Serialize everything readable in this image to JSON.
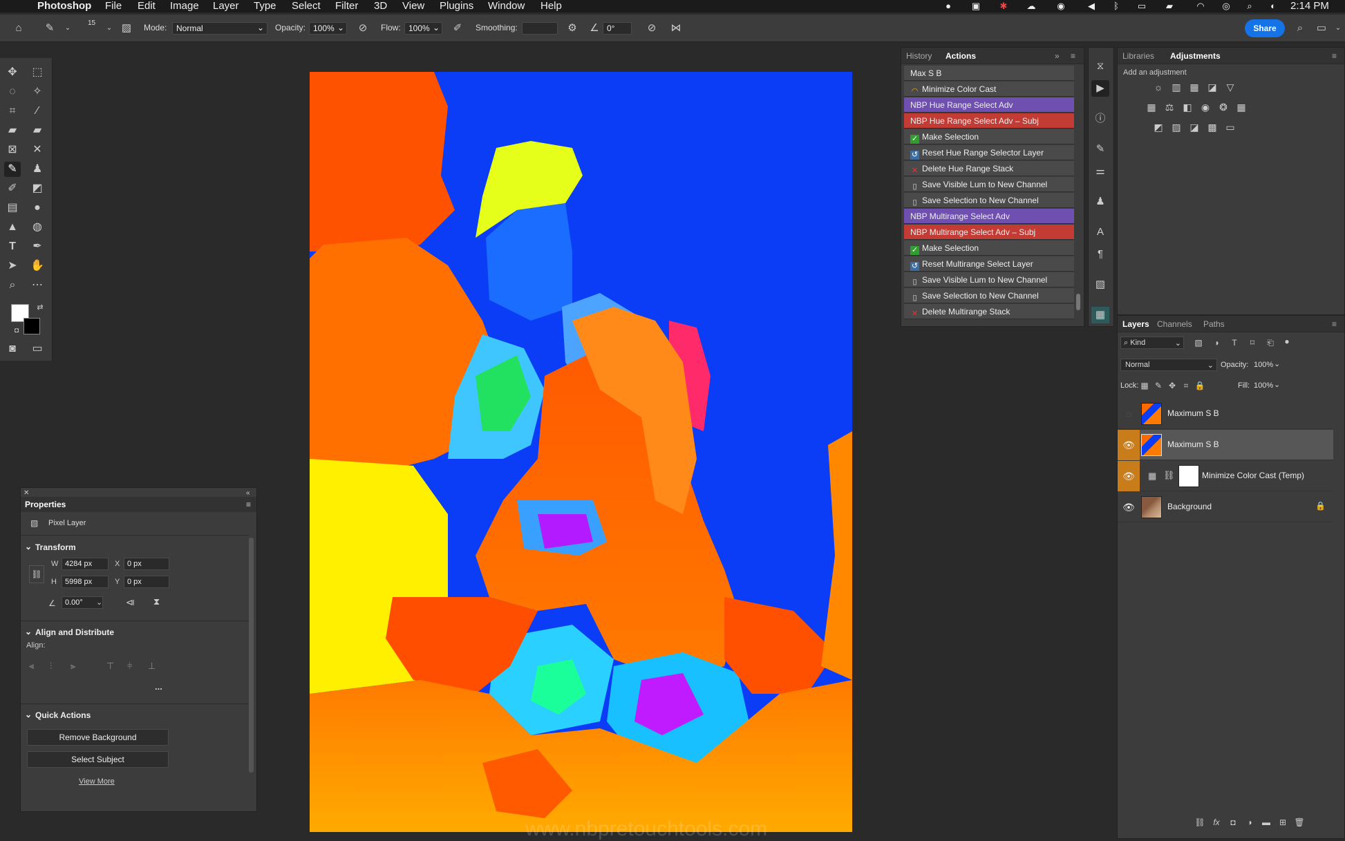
{
  "menubar": {
    "apple": "",
    "app_name": "Photoshop",
    "items": [
      "File",
      "Edit",
      "Image",
      "Layer",
      "Type",
      "Select",
      "Filter",
      "3D",
      "View",
      "Plugins",
      "Window",
      "Help"
    ],
    "clock": "2:14 PM"
  },
  "options_bar": {
    "brush_size": "15",
    "mode_label": "Mode:",
    "mode_value": "Normal",
    "opacity_label": "Opacity:",
    "opacity_value": "100%",
    "flow_label": "Flow:",
    "flow_value": "100%",
    "smoothing_label": "Smoothing:",
    "smoothing_value": "",
    "angle_value": "0°",
    "share_label": "Share"
  },
  "actions_panel": {
    "tabs": [
      "History",
      "Actions"
    ],
    "active_tab": "Actions",
    "rows": [
      {
        "label": "Max S B",
        "style": "plain",
        "icon": ""
      },
      {
        "label": "Minimize Color Cast",
        "style": "plain",
        "icon": "rainbow-icon"
      },
      {
        "label": "NBP Hue Range Select Adv",
        "style": "purple",
        "icon": ""
      },
      {
        "label": "NBP Hue Range Select Adv – Subj",
        "style": "red",
        "icon": ""
      },
      {
        "label": "Make Selection",
        "style": "plain",
        "icon": "check-icon"
      },
      {
        "label": "Reset Hue Range Selector Layer",
        "style": "plain",
        "icon": "reset-icon"
      },
      {
        "label": "Delete Hue Range Stack",
        "style": "plain",
        "icon": "x-icon"
      },
      {
        "label": "Save Visible Lum to New Channel",
        "style": "plain",
        "icon": "doc-icon"
      },
      {
        "label": "Save Selection to New Channel",
        "style": "plain",
        "icon": "doc-icon"
      },
      {
        "label": "NBP Multirange Select Adv",
        "style": "purple",
        "icon": ""
      },
      {
        "label": "NBP Multirange Select Adv – Subj",
        "style": "red",
        "icon": ""
      },
      {
        "label": "Make Selection",
        "style": "plain",
        "icon": "check-icon"
      },
      {
        "label": "Reset Multirange Select Layer",
        "style": "plain",
        "icon": "reset-icon"
      },
      {
        "label": "Save Visible Lum to New Channel",
        "style": "plain",
        "icon": "doc-icon"
      },
      {
        "label": "Save Selection to New Channel",
        "style": "plain",
        "icon": "doc-icon"
      },
      {
        "label": "Delete Multirange Stack",
        "style": "plain",
        "icon": "x-icon"
      }
    ]
  },
  "adjustments_panel": {
    "tabs": [
      "Libraries",
      "Adjustments"
    ],
    "active_tab": "Adjustments",
    "hint": "Add an adjustment"
  },
  "layers_panel": {
    "tabs": [
      "Layers",
      "Channels",
      "Paths"
    ],
    "active_tab": "Layers",
    "filter_kind": "Kind",
    "blend_mode": "Normal",
    "opacity_label": "Opacity:",
    "opacity_value": "100%",
    "lock_label": "Lock:",
    "fill_label": "Fill:",
    "fill_value": "100%",
    "layers": [
      {
        "name": "Maximum S B",
        "visible": false,
        "selected": false
      },
      {
        "name": "Maximum S B",
        "visible": true,
        "selected": true
      },
      {
        "name": "Minimize Color Cast (Temp)",
        "visible": true,
        "selected": false
      },
      {
        "name": "Background",
        "visible": true,
        "selected": false
      }
    ]
  },
  "properties_panel": {
    "title": "Properties",
    "layer_type": "Pixel Layer",
    "transform_label": "Transform",
    "w_label": "W",
    "w_value": "4284 px",
    "x_label": "X",
    "x_value": "0 px",
    "h_label": "H",
    "h_value": "5998 px",
    "y_label": "Y",
    "y_value": "0 px",
    "angle_value": "0.00°",
    "align_section": "Align and Distribute",
    "align_label": "Align:",
    "more": "...",
    "quick_actions_label": "Quick Actions",
    "remove_bg": "Remove Background",
    "select_subject": "Select Subject",
    "view_more": "View More"
  },
  "watermark": "www.nbpretouchtools.com"
}
